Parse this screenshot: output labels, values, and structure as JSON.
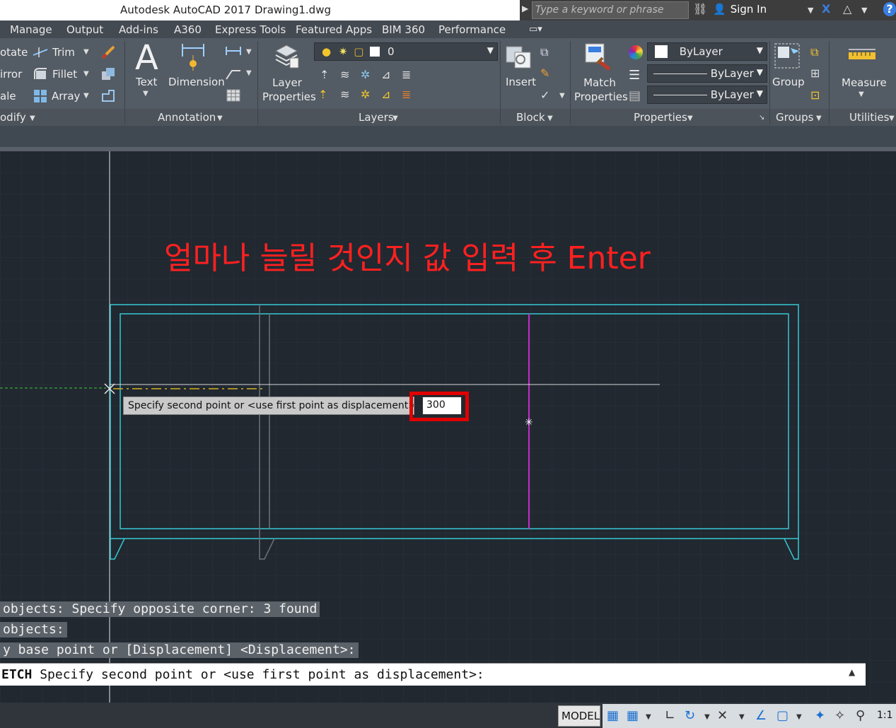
{
  "titlebar": {
    "app_name": "Autodesk AutoCAD 2017",
    "file_name": "Drawing1.dwg",
    "search_placeholder": "Type a keyword or phrase",
    "sign_in": "Sign In"
  },
  "tabs": [
    "Manage",
    "Output",
    "Add-ins",
    "A360",
    "Express Tools",
    "Featured Apps",
    "BIM 360",
    "Performance"
  ],
  "ribbon": {
    "modify": {
      "title": "odify",
      "items": [
        "otate",
        "irror",
        "ale"
      ],
      "tools": [
        "Trim",
        "Fillet",
        "Array"
      ]
    },
    "annotation": {
      "title": "Annotation",
      "text_label": "Text",
      "dimension_label": "Dimension"
    },
    "layers": {
      "title": "Layers",
      "layer_properties": "Layer Properties",
      "current_layer": "0"
    },
    "block": {
      "title": "Block",
      "insert_label": "Insert"
    },
    "properties": {
      "title": "Properties",
      "match_properties": "Match Properties",
      "color": "ByLayer",
      "linetype": "ByLayer",
      "lineweight": "ByLayer"
    },
    "groups": {
      "title": "Groups",
      "group_label": "Group"
    },
    "utilities": {
      "title": "Utilities",
      "measure_label": "Measure"
    }
  },
  "canvas": {
    "annotation_text": "얼마나 늘릴 것인지 값 입력 후 Enter",
    "tooltip_prompt": "Specify second point or <use first point as displacement>:",
    "tooltip_value": "300"
  },
  "command_history": [
    "objects: Specify opposite corner: 3 found",
    "objects:",
    "y base point or [Displacement] <Displacement>:"
  ],
  "command_line": {
    "command": "ETCH",
    "prompt": "Specify second point or <use first point as displacement>:"
  },
  "statusbar": {
    "model": "MODEL",
    "scale": "1:1"
  },
  "colors": {
    "canvas_bg": "#212830",
    "cyan_lines": "#35c8d4",
    "magenta_line": "#c02ec8",
    "highlight_red": "#e00000",
    "annotation_red": "#ff2020"
  }
}
